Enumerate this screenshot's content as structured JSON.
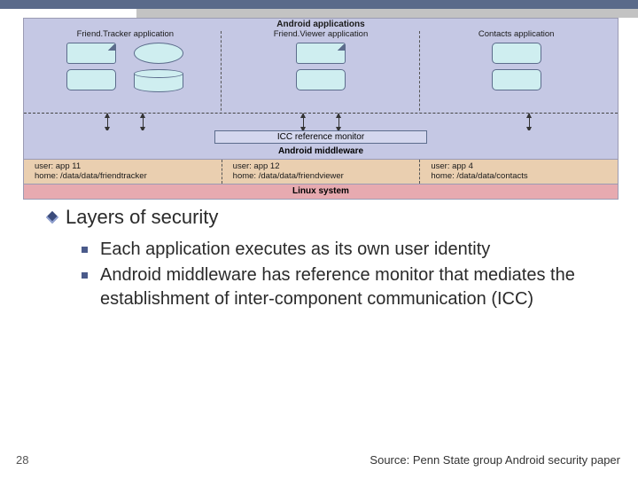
{
  "diagram": {
    "apps_title": "Android applications",
    "columns": [
      {
        "title": "Friend.Tracker application",
        "shapes": [
          "note",
          "ellipse",
          "rect",
          "cylinder"
        ]
      },
      {
        "title": "Friend.Viewer application",
        "shapes": [
          "note",
          "rect"
        ]
      },
      {
        "title": "Contacts application",
        "shapes": [
          "rect",
          "rect"
        ]
      }
    ],
    "icc_label": "ICC reference monitor",
    "middleware_label": "Android middleware",
    "users": [
      {
        "user": "user: app 11",
        "home": "home: /data/data/friendtracker"
      },
      {
        "user": "user: app 12",
        "home": "home: /data/data/friendviewer"
      },
      {
        "user": "user: app 4",
        "home": "home: /data/data/contacts"
      }
    ],
    "linux_label": "Linux system"
  },
  "heading": "Layers of security",
  "bullets": [
    "Each application executes as its own user identity",
    "Android middleware has reference monitor that mediates the establishment of inter-component communication (ICC)"
  ],
  "page_number": "28",
  "source": "Source: Penn State group Android security paper"
}
